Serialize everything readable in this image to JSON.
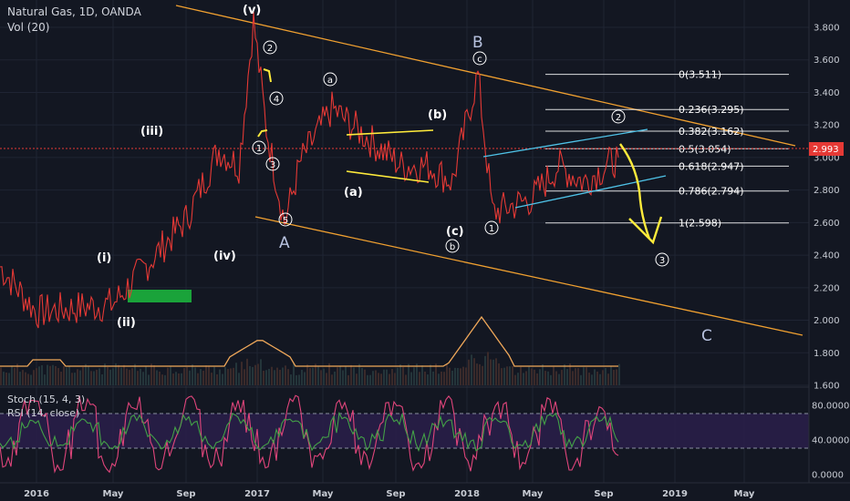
{
  "header": {
    "symbol_line": "Natural Gas, 1D, OANDA",
    "volume_label": "Vol (20)",
    "stoch_label": "Stoch (15, 4, 3)",
    "rsi_label": "RSI (14, close)"
  },
  "colors": {
    "background": "#131722",
    "price_line": "#e53935",
    "channel": "#f0a030",
    "wedge": "#4fc3e8",
    "range_box": "#ffeb3b",
    "projection": "#ffeb3b",
    "support_box": "#1aa33a",
    "stoch": "#e0457b",
    "rsi": "#43a047",
    "volume_ma": "#f0a85a"
  },
  "price_axis": {
    "ticks": [
      "3.800",
      "3.600",
      "3.400",
      "3.200",
      "3.000",
      "2.800",
      "2.600",
      "2.400",
      "2.200",
      "2.000",
      "1.800",
      "1.600"
    ],
    "current_price": "2.993"
  },
  "oscillator_axis": {
    "ticks": [
      "80.0000",
      "40.0000",
      "0.0000"
    ]
  },
  "time_axis": {
    "ticks": [
      "2016",
      "May",
      "Sep",
      "2017",
      "May",
      "Sep",
      "2018",
      "May",
      "Sep",
      "2019",
      "May"
    ]
  },
  "fib_levels": [
    {
      "label": "0(3.511)",
      "price": 3.511
    },
    {
      "label": "0.236(3.295)",
      "price": 3.295
    },
    {
      "label": "0.382(3.162)",
      "price": 3.162
    },
    {
      "label": "0.5(3.054)",
      "price": 3.054
    },
    {
      "label": "0.618(2.947)",
      "price": 2.947
    },
    {
      "label": "0.786(2.794)",
      "price": 2.794
    },
    {
      "label": "1(2.598)",
      "price": 2.598
    }
  ],
  "wave_labels": [
    {
      "text": "(v)",
      "style": "bold"
    },
    {
      "text": "(iii)",
      "style": "bold"
    },
    {
      "text": "(iv)",
      "style": "bold"
    },
    {
      "text": "(i)",
      "style": "bold"
    },
    {
      "text": "(ii)",
      "style": "bold"
    },
    {
      "text": "(a)",
      "style": "bold"
    },
    {
      "text": "(b)",
      "style": "bold"
    },
    {
      "text": "(c)",
      "style": "bold"
    },
    {
      "text": "A",
      "style": "big"
    },
    {
      "text": "B",
      "style": "big"
    },
    {
      "text": "C",
      "style": "big"
    }
  ],
  "circled_labels": [
    "2",
    "4",
    "1",
    "3",
    "5",
    "a",
    "c",
    "b",
    "1",
    "2",
    "3"
  ],
  "chart_data": {
    "type": "line",
    "title": "Natural Gas, 1D, OANDA",
    "x": [
      "2016-01",
      "2016-03",
      "2016-05",
      "2016-07",
      "2016-09",
      "2016-11",
      "2016-12",
      "2017-01",
      "2017-02",
      "2017-03",
      "2017-05",
      "2017-07",
      "2017-09",
      "2017-11",
      "2018-01",
      "2018-02",
      "2018-04",
      "2018-06",
      "2018-08",
      "2018-09"
    ],
    "series": [
      {
        "values": [
          2.33,
          2.05,
          2.1,
          2.62,
          3.05,
          2.95,
          3.84,
          3.18,
          2.6,
          2.98,
          3.3,
          2.95,
          2.95,
          2.85,
          3.51,
          2.66,
          2.75,
          2.95,
          2.85,
          3.0
        ]
      }
    ],
    "ylim": [
      1.45,
      3.92
    ],
    "last_price": 2.993,
    "grid": true,
    "legend": "none"
  }
}
